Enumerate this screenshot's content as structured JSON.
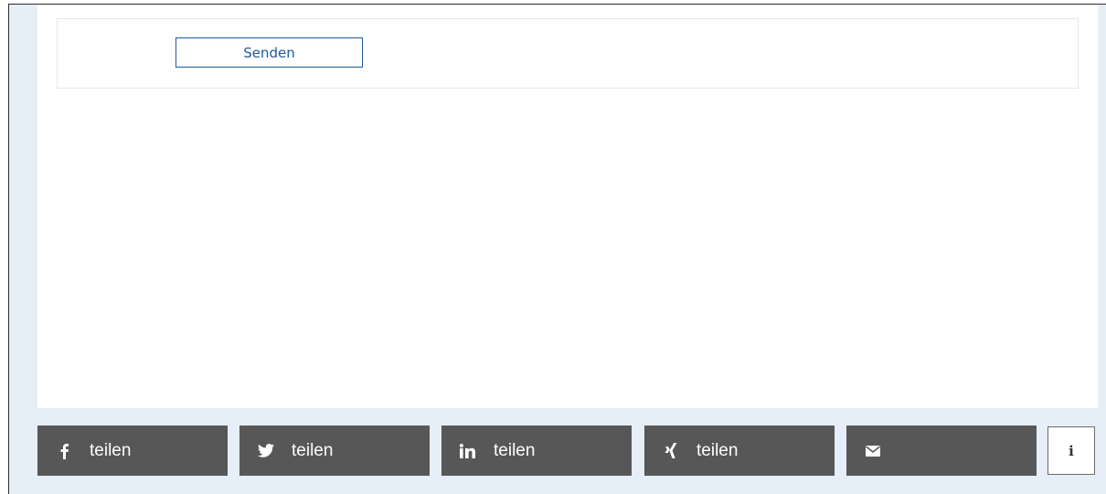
{
  "form": {
    "send_label": "Senden"
  },
  "share": {
    "buttons": [
      {
        "icon": "facebook-icon",
        "label": "teilen"
      },
      {
        "icon": "twitter-icon",
        "label": "teilen"
      },
      {
        "icon": "linkedin-icon",
        "label": "teilen"
      },
      {
        "icon": "xing-icon",
        "label": "teilen"
      },
      {
        "icon": "email-icon",
        "label": ""
      }
    ],
    "info_label": "i"
  },
  "colors": {
    "page_background": "#e6eef7",
    "share_button_bg": "#575757",
    "accent": "#1d5a9b"
  }
}
